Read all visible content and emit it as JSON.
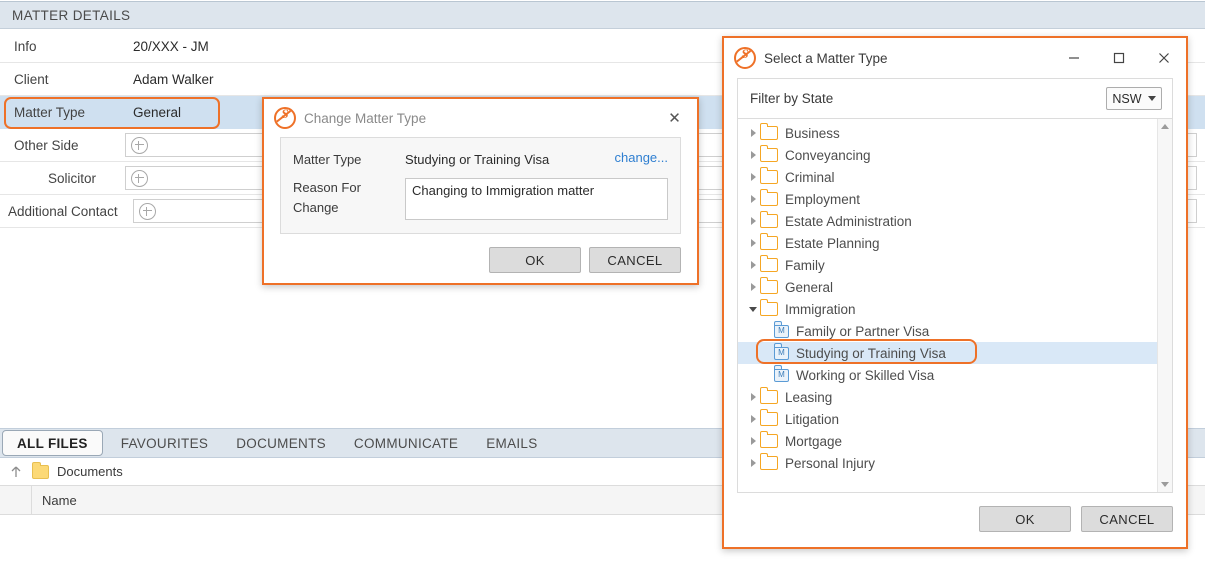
{
  "matter_panel": {
    "header_title": "MATTER DETAILS",
    "rows": [
      {
        "label": "Info",
        "value": "20/XXX - JM",
        "type": "text",
        "indent": false,
        "highlighted": false
      },
      {
        "label": "Client",
        "value": "Adam Walker",
        "type": "text",
        "indent": false,
        "highlighted": false
      },
      {
        "label": "Matter Type",
        "value": "General",
        "type": "text",
        "indent": false,
        "highlighted": true
      },
      {
        "label": "Other Side",
        "value": "",
        "type": "add",
        "indent": false,
        "highlighted": false
      },
      {
        "label": "Solicitor",
        "value": "",
        "type": "add",
        "indent": true,
        "highlighted": false
      },
      {
        "label": "Additional Contact",
        "value": "",
        "type": "add",
        "indent": false,
        "highlighted": false
      }
    ]
  },
  "files_section": {
    "tabs": [
      {
        "label": "ALL FILES",
        "active": true
      },
      {
        "label": "FAVOURITES",
        "active": false
      },
      {
        "label": "DOCUMENTS",
        "active": false
      },
      {
        "label": "COMMUNICATE",
        "active": false
      },
      {
        "label": "EMAILS",
        "active": false
      }
    ],
    "breadcrumb": "Documents",
    "columns": [
      "Name"
    ]
  },
  "change_matter_type_dialog": {
    "title": "Change Matter Type",
    "close_label": "✕",
    "matter_type_label": "Matter Type",
    "matter_type_value": "Studying or Training Visa",
    "change_link": "change...",
    "reason_label": "Reason For Change",
    "reason_value": "Changing to Immigration matter",
    "ok_label": "OK",
    "cancel_label": "CANCEL"
  },
  "select_matter_type_dialog": {
    "title": "Select a Matter Type",
    "minimize_label": "—",
    "maximize_label": "☐",
    "close_label": "✕",
    "filter_label": "Filter by State",
    "state_value": "NSW",
    "tree": [
      {
        "label": "Business",
        "kind": "folder",
        "expanded": false,
        "child": false,
        "selected": false
      },
      {
        "label": "Conveyancing",
        "kind": "folder",
        "expanded": false,
        "child": false,
        "selected": false
      },
      {
        "label": "Criminal",
        "kind": "folder",
        "expanded": false,
        "child": false,
        "selected": false
      },
      {
        "label": "Employment",
        "kind": "folder",
        "expanded": false,
        "child": false,
        "selected": false
      },
      {
        "label": "Estate Administration",
        "kind": "folder",
        "expanded": false,
        "child": false,
        "selected": false
      },
      {
        "label": "Estate Planning",
        "kind": "folder",
        "expanded": false,
        "child": false,
        "selected": false
      },
      {
        "label": "Family",
        "kind": "folder",
        "expanded": false,
        "child": false,
        "selected": false
      },
      {
        "label": "General",
        "kind": "folder",
        "expanded": false,
        "child": false,
        "selected": false
      },
      {
        "label": "Immigration",
        "kind": "folder",
        "expanded": true,
        "child": false,
        "selected": false
      },
      {
        "label": "Family or Partner Visa",
        "kind": "doc",
        "expanded": false,
        "child": true,
        "selected": false
      },
      {
        "label": "Studying or Training Visa",
        "kind": "doc",
        "expanded": false,
        "child": true,
        "selected": true
      },
      {
        "label": "Working or Skilled Visa",
        "kind": "doc",
        "expanded": false,
        "child": true,
        "selected": false
      },
      {
        "label": "Leasing",
        "kind": "folder",
        "expanded": false,
        "child": false,
        "selected": false
      },
      {
        "label": "Litigation",
        "kind": "folder",
        "expanded": false,
        "child": false,
        "selected": false
      },
      {
        "label": "Mortgage",
        "kind": "folder",
        "expanded": false,
        "child": false,
        "selected": false
      },
      {
        "label": "Personal Injury",
        "kind": "folder",
        "expanded": false,
        "child": false,
        "selected": false
      }
    ],
    "ok_label": "OK",
    "cancel_label": "CANCEL"
  },
  "colors": {
    "accent_orange": "#ee7128",
    "header_bar": "#dde5ed",
    "row_highlight": "#cfe0f0",
    "tree_selection": "#d9e8f7",
    "link_blue": "#2f7fd1",
    "folder_orange": "#f5a623",
    "doc_blue": "#5b9bd5"
  }
}
